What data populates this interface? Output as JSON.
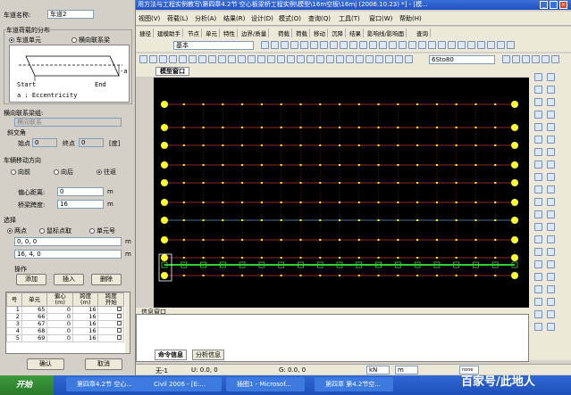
{
  "dialog": {
    "lane_name_label": "车道名称:",
    "lane_name_value": "车道2",
    "distribution_label": "车道荷载的分布",
    "radio_lane_unit": "车道单元",
    "radio_cross_beam": "横向联系梁",
    "diagram_start": "Start",
    "diagram_end": "End",
    "diagram_a": "-a",
    "diagram_ecc": "a : Eccentricity",
    "cross_group_label": "横向联系梁组:",
    "cross_group_value": "横向联系",
    "skew_label": "斜交角",
    "start_label": "始点",
    "start_value": "0",
    "end_label": "终点",
    "end_value": "0",
    "deg_label": "[度]",
    "vehicle_dir_label": "车辆移动方向",
    "dir_forward": "向前",
    "dir_backward": "向后",
    "dir_return": "往返",
    "ecc_dist_label": "偏心距离:",
    "ecc_dist_value": "0",
    "ecc_unit": "m",
    "bridge_span_label": "桥梁跨度:",
    "bridge_span_value": "16",
    "span_unit": "m",
    "select_label": "选择",
    "sel_two_points": "两点",
    "sel_mouse": "鼠标点取",
    "sel_unit_no": "单元号",
    "point1_value": "0, 0, 0",
    "point2_value": "16, 4, 0",
    "point_unit": "m",
    "ops_label": "操作",
    "add_btn": "添加",
    "insert_btn": "插入",
    "delete_btn": "删除",
    "table_headers": [
      "号",
      "单元",
      "偏心\n(m)",
      "跨度\n(m)",
      "跨度\n开始"
    ],
    "table_rows": [
      [
        "1",
        "65",
        "0",
        "16",
        ""
      ],
      [
        "2",
        "66",
        "0",
        "16",
        ""
      ],
      [
        "3",
        "67",
        "0",
        "16",
        ""
      ],
      [
        "4",
        "68",
        "0",
        "16",
        ""
      ],
      [
        "5",
        "69",
        "0",
        "16",
        ""
      ]
    ],
    "ok_btn": "确认",
    "cancel_btn": "取消"
  },
  "window": {
    "title": "用方法与工程实例教写\\第四章4.2节 空心板梁桥工程实例\\模型\\16m空板\\16mj (2006.10.23) *] - [模...",
    "menus": [
      "视图(V)",
      "荷载(L)",
      "分析(A)",
      "结果(R)",
      "设计(D)",
      "模式(O)",
      "查询(Q)",
      "工具(T)",
      "窗口(W)",
      "帮助(H)"
    ],
    "toolbar_tabs": [
      "捷径",
      "建模助手",
      "节点",
      "单元",
      "特性",
      "边界/质量",
      "荷载",
      "荷载",
      "移动",
      "沉降",
      "结果",
      "影响线/影响面",
      "查询"
    ],
    "dropdown_base": "基本",
    "dropdown_group": "6Sto80",
    "view_tab": "模型窗口",
    "msg_title": "信息窗口",
    "msg_tab1": "命令信息",
    "msg_tab2": "分析信息",
    "status_unit": "无-1",
    "status_u": "U: 0.0, 0",
    "status_g": "G: 0.0, 0",
    "status_kn": "kN",
    "status_m": "m",
    "status_none": "none"
  },
  "taskbar": {
    "start": "开始",
    "tasks": [
      "第四章4.2节 空心...",
      "Civil 2006 - [E:...",
      "插图1 - Microsof...",
      "第四章 第4.2节空..."
    ],
    "watermark": "百家号/此地人"
  },
  "colors": {
    "grid_line": "#cc3333",
    "grid_blue": "#6699cc",
    "node": "#ffff00",
    "support": "#ffff33",
    "lane": "#33cc33",
    "title_bar": "#2150c0"
  }
}
